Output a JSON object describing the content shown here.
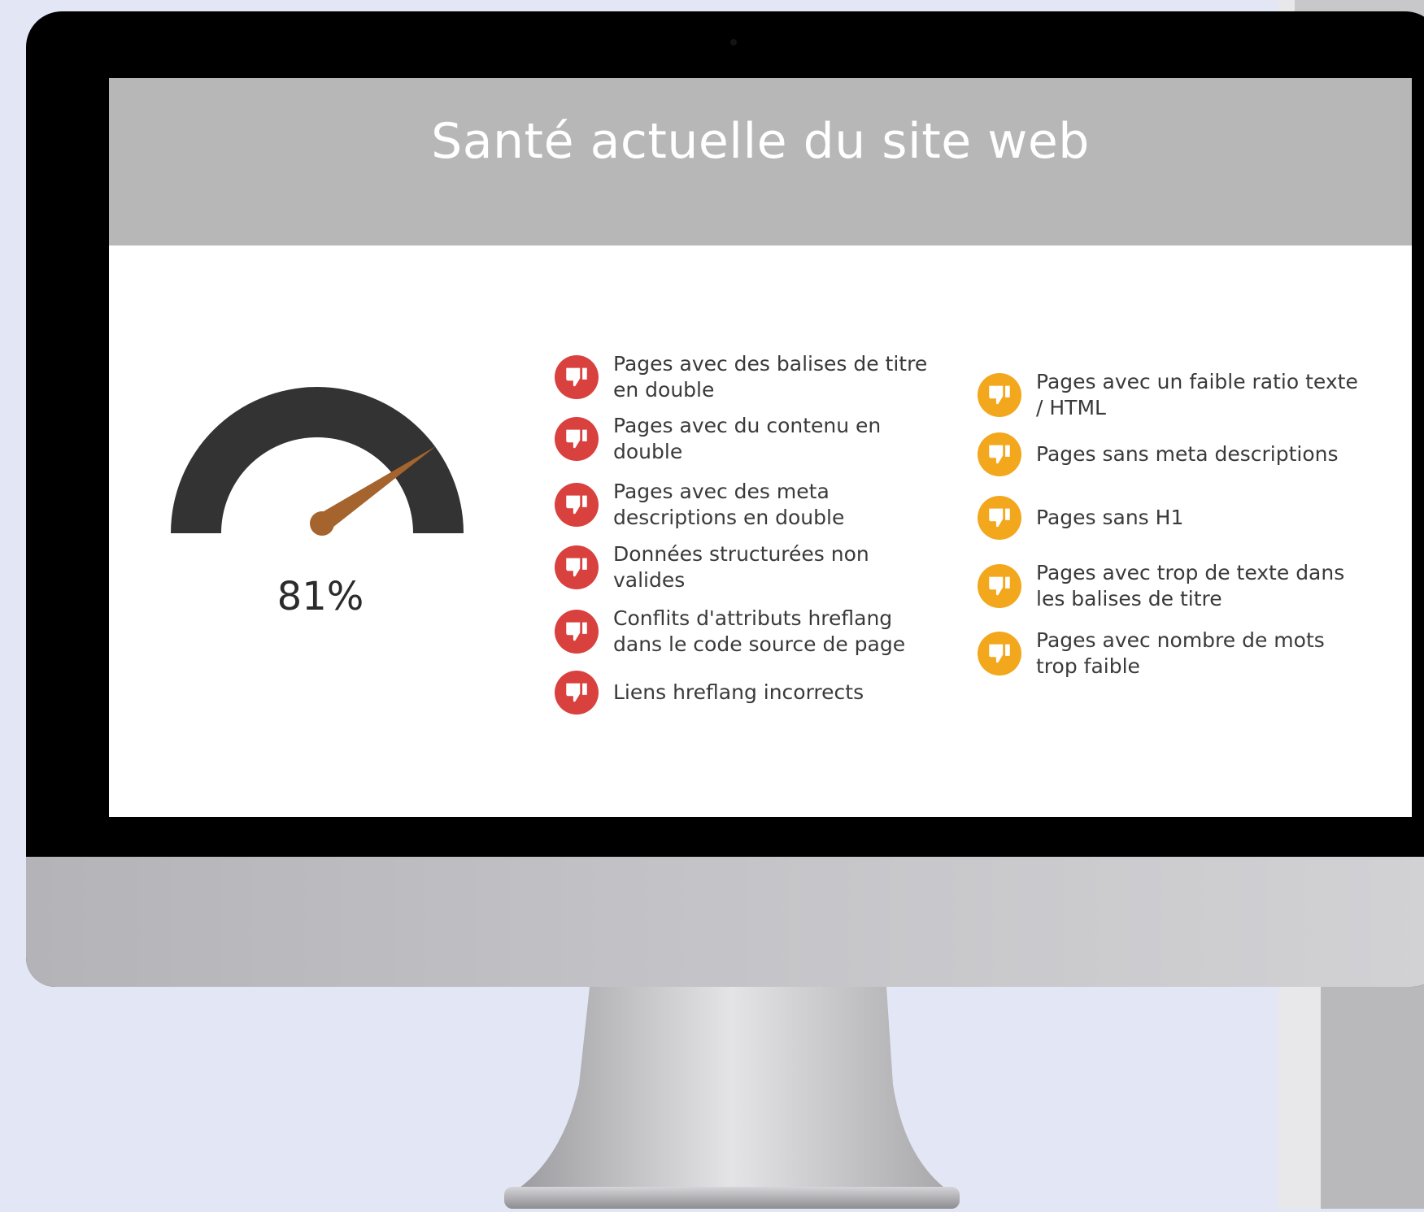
{
  "screen": {
    "title": "Santé actuelle du site web"
  },
  "health": {
    "score_text": "81%",
    "score": 81
  },
  "issues_errors": [
    {
      "label": "Pages avec des balises de titre en double",
      "icon": "thumbs-down-icon"
    },
    {
      "label": "Pages avec du contenu en double",
      "icon": "thumbs-down-icon"
    },
    {
      "label": "Pages avec des meta descriptions en double",
      "icon": "thumbs-down-icon"
    },
    {
      "label": "Données structurées non valides",
      "icon": "thumbs-down-icon"
    },
    {
      "label": "Conflits d'attributs hreflang dans le code source de page",
      "icon": "thumbs-down-icon"
    },
    {
      "label": "Liens hreflang incorrects",
      "icon": "thumbs-down-icon"
    }
  ],
  "issues_warnings": [
    {
      "label": "Pages avec un faible ratio texte / HTML",
      "icon": "thumbs-down-icon"
    },
    {
      "label": "Pages sans meta descriptions",
      "icon": "thumbs-down-icon"
    },
    {
      "label": "Pages sans H1",
      "icon": "thumbs-down-icon"
    },
    {
      "label": "Pages avec trop de texte dans les balises de titre",
      "icon": "thumbs-down-icon"
    },
    {
      "label": "Pages avec nombre de mots trop faible",
      "icon": "thumbs-down-icon"
    }
  ],
  "colors": {
    "error": "#d9413f",
    "warning": "#f2a71c",
    "gauge_arc": "#333333",
    "gauge_needle": "#a5642e",
    "header_bg": "#b7b7b7"
  }
}
